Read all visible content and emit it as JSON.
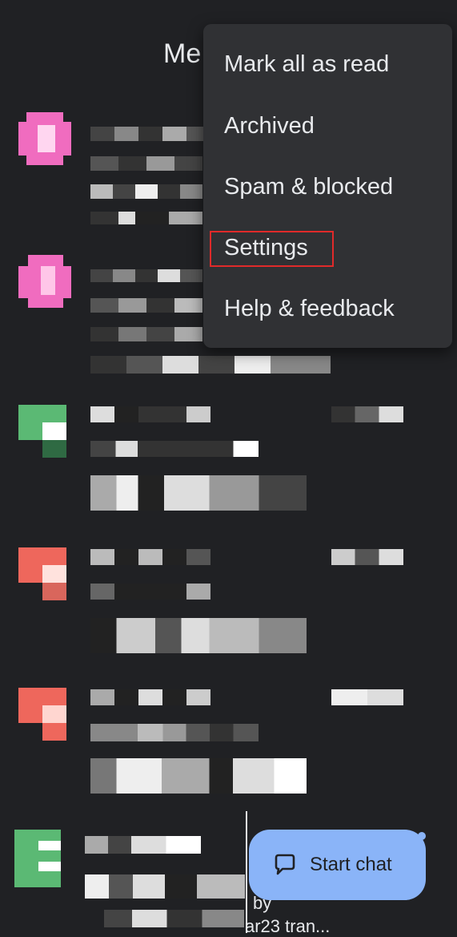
{
  "header": {
    "title_partial": "Me"
  },
  "menu": {
    "items": [
      {
        "label": "Mark all as read"
      },
      {
        "label": "Archived"
      },
      {
        "label": "Spam & blocked"
      },
      {
        "label": "Settings"
      },
      {
        "label": "Help & feedback"
      }
    ],
    "highlighted_item": "Settings"
  },
  "conversations": [
    {
      "avatar_color": "#f06cbf"
    },
    {
      "avatar_color": "#f06cbf"
    },
    {
      "avatar_color": "#5bb974"
    },
    {
      "avatar_color": "#ee675c"
    },
    {
      "avatar_color": "#ee675c"
    },
    {
      "avatar_color": "#5bb974"
    }
  ],
  "fab": {
    "label": "Start chat",
    "icon": "chat-bubble-icon"
  },
  "partial_text": {
    "line1": "by",
    "line2": "ar23 tran..."
  },
  "colors": {
    "background": "#202124",
    "menu_bg": "#303134",
    "accent": "#8ab4f8",
    "highlight": "#e02a2a"
  }
}
